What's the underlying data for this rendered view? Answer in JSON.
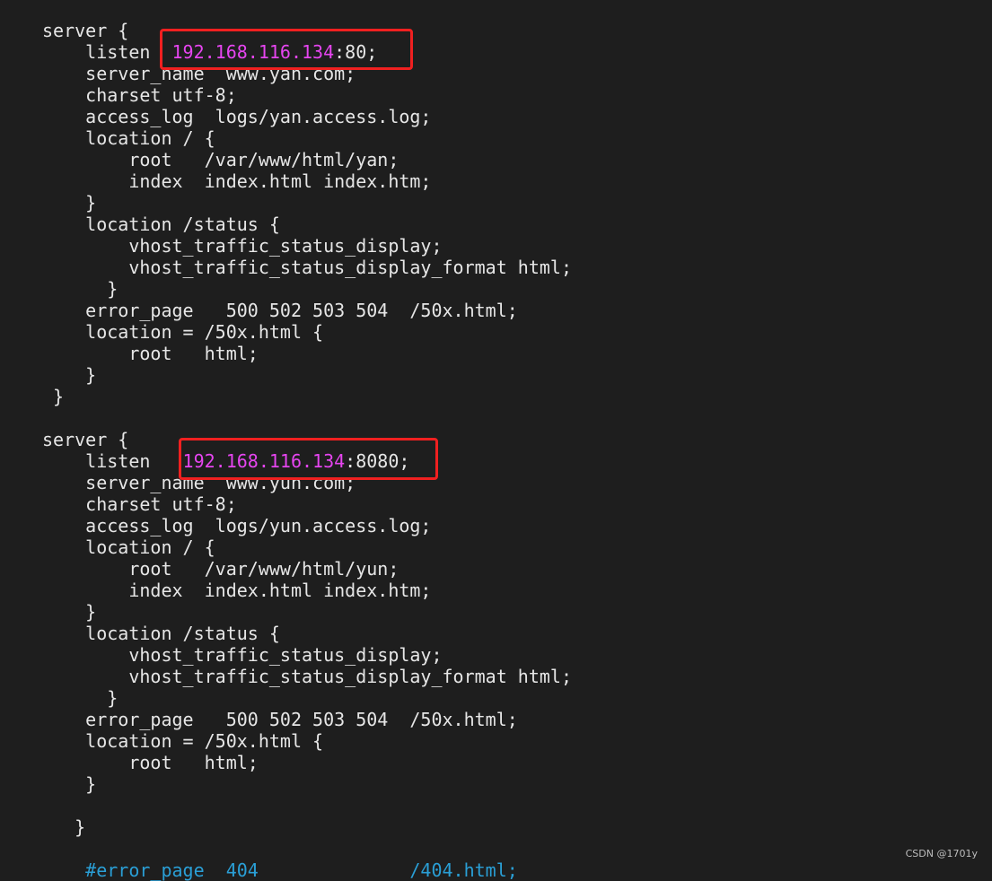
{
  "colors": {
    "background": "#1e1e1e",
    "text": "#e6e6e6",
    "ip_highlight": "#e645f0",
    "comment": "#2a9fd6",
    "annotation_box": "#f02020"
  },
  "lines": [
    [
      {
        "t": "server {"
      }
    ],
    [
      {
        "t": "    listen  "
      },
      {
        "t": "192.168.116.134",
        "c": "ip"
      },
      {
        "t": ":80;"
      }
    ],
    [
      {
        "t": "    server_name  www.yan.com;"
      }
    ],
    [
      {
        "t": "    charset utf-8;"
      }
    ],
    [
      {
        "t": "    access_log  logs/yan.access.log;"
      }
    ],
    [
      {
        "t": "    location / {"
      }
    ],
    [
      {
        "t": "        root   /var/www/html/yan;"
      }
    ],
    [
      {
        "t": "        index  index.html index.htm;"
      }
    ],
    [
      {
        "t": "    }"
      }
    ],
    [
      {
        "t": "    location /status {"
      }
    ],
    [
      {
        "t": "        vhost_traffic_status_display;"
      }
    ],
    [
      {
        "t": "        vhost_traffic_status_display_format html;"
      }
    ],
    [
      {
        "t": "      }"
      }
    ],
    [
      {
        "t": "    error_page   500 502 503 504  /50x.html;"
      }
    ],
    [
      {
        "t": "    location = /50x.html {"
      }
    ],
    [
      {
        "t": "        root   html;"
      }
    ],
    [
      {
        "t": "    }"
      }
    ],
    [
      {
        "t": " }"
      }
    ],
    [
      {
        "t": ""
      }
    ],
    [
      {
        "t": "server {"
      }
    ],
    [
      {
        "t": "    listen   "
      },
      {
        "t": "192.168.116.134",
        "c": "ip"
      },
      {
        "t": ":8080;"
      }
    ],
    [
      {
        "t": "    server_name  www.yun.com;"
      }
    ],
    [
      {
        "t": "    charset utf-8;"
      }
    ],
    [
      {
        "t": "    access_log  logs/yun.access.log;"
      }
    ],
    [
      {
        "t": "    location / {"
      }
    ],
    [
      {
        "t": "        root   /var/www/html/yun;"
      }
    ],
    [
      {
        "t": "        index  index.html index.htm;"
      }
    ],
    [
      {
        "t": "    }"
      }
    ],
    [
      {
        "t": "    location /status {"
      }
    ],
    [
      {
        "t": "        vhost_traffic_status_display;"
      }
    ],
    [
      {
        "t": "        vhost_traffic_status_display_format html;"
      }
    ],
    [
      {
        "t": "      }"
      }
    ],
    [
      {
        "t": "    error_page   500 502 503 504  /50x.html;"
      }
    ],
    [
      {
        "t": "    location = /50x.html {"
      }
    ],
    [
      {
        "t": "        root   html;"
      }
    ],
    [
      {
        "t": "    }"
      }
    ],
    [
      {
        "t": ""
      }
    ],
    [
      {
        "t": "   }"
      }
    ],
    [
      {
        "t": ""
      }
    ],
    [
      {
        "t": "    #error_page  404              /404.html;",
        "c": "comment"
      }
    ]
  ],
  "watermark": "CSDN @1701y"
}
